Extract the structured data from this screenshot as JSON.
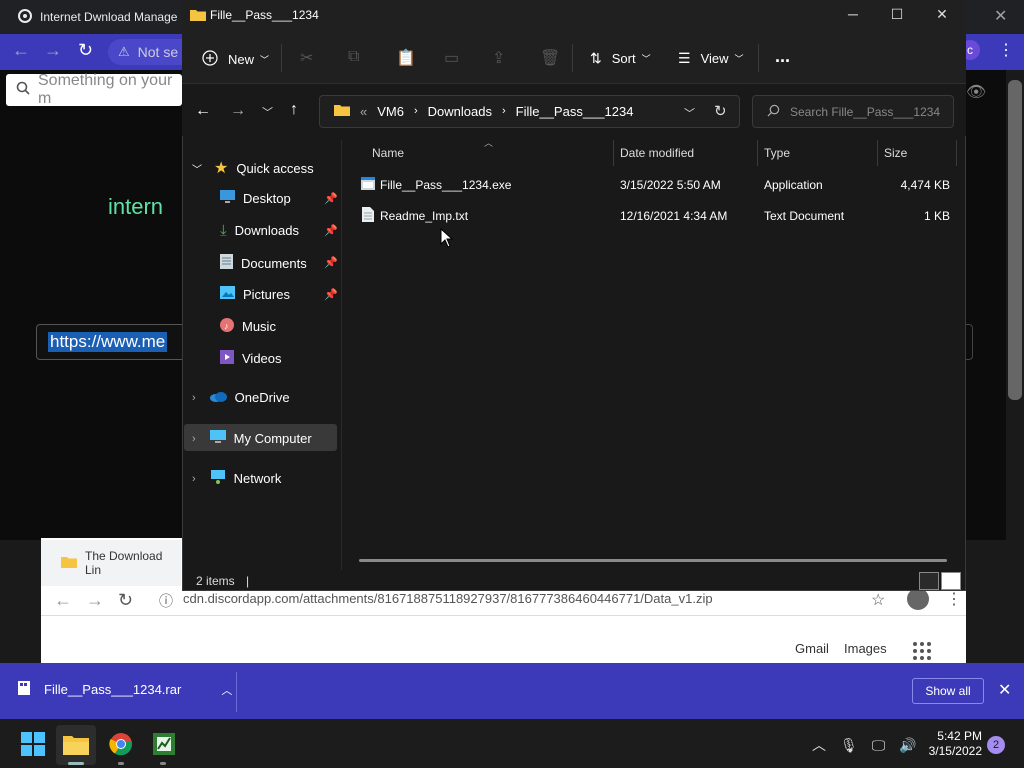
{
  "background_browser": {
    "tab_title": "Internet Dwnload Manage",
    "address_partial": "Not se",
    "search_placeholder": "Something on your m",
    "heading_partial": "intern",
    "url_partial": "https://www.me",
    "profile_initial": "c"
  },
  "second_browser": {
    "tab_title": "The Download Lin",
    "url": "cdn.discordapp.com/attachments/816718875118927937/816777386460446771/Data_v1.zip",
    "links": [
      "Gmail",
      "Images"
    ]
  },
  "explorer": {
    "title": "Fille__Pass___1234",
    "toolbar": {
      "new_label": "New",
      "sort_label": "Sort",
      "view_label": "View",
      "more_label": "..."
    },
    "breadcrumb": [
      "VM6",
      "Downloads",
      "Fille__Pass___1234"
    ],
    "breadcrumb_prefix": "«",
    "search_placeholder": "Search Fille__Pass___1234",
    "sidebar": {
      "quick_access": "Quick access",
      "items": [
        {
          "label": "Desktop",
          "pinned": true,
          "icon": "desktop-icon"
        },
        {
          "label": "Downloads",
          "pinned": true,
          "icon": "download-icon"
        },
        {
          "label": "Documents",
          "pinned": true,
          "icon": "document-icon"
        },
        {
          "label": "Pictures",
          "pinned": true,
          "icon": "picture-icon"
        },
        {
          "label": "Music",
          "pinned": false,
          "icon": "music-icon"
        },
        {
          "label": "Videos",
          "pinned": false,
          "icon": "video-icon"
        }
      ],
      "onedrive": "OneDrive",
      "my_computer": "My Computer",
      "network": "Network"
    },
    "columns": {
      "name": "Name",
      "date": "Date modified",
      "type": "Type",
      "size": "Size"
    },
    "files": [
      {
        "name": "Fille__Pass___1234.exe",
        "date": "3/15/2022 5:50 AM",
        "type": "Application",
        "size": "4,474 KB"
      },
      {
        "name": "Readme_Imp.txt",
        "date": "12/16/2021 4:34 AM",
        "type": "Text Document",
        "size": "1 KB"
      }
    ],
    "status": "2 items",
    "status_cursor": "|"
  },
  "download_bar": {
    "file": "Fille__Pass___1234.rar",
    "show_all": "Show all"
  },
  "taskbar": {
    "time": "5:42 PM",
    "date": "3/15/2022",
    "notifications": "2"
  },
  "colors": {
    "accent_blue": "#3c3ab8",
    "explorer_bg": "#191919",
    "folder_yellow": "#f5c542"
  }
}
